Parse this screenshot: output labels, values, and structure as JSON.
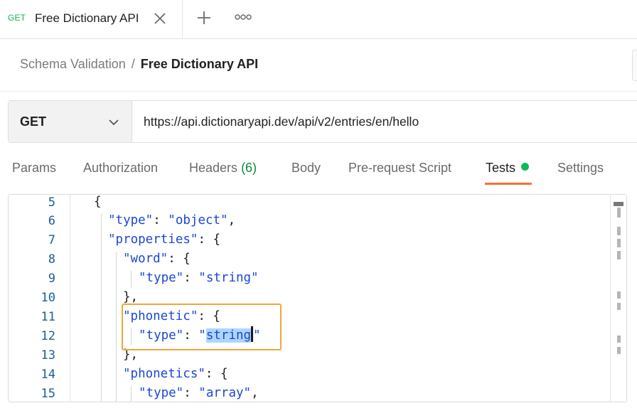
{
  "tab": {
    "method": "GET",
    "title": "Free Dictionary API",
    "close_icon": "close-icon",
    "add_icon": "plus-icon",
    "more_icon": "more-options-icon"
  },
  "breadcrumb": {
    "parent": "Schema Validation",
    "separator": "/",
    "current": "Free Dictionary API"
  },
  "request": {
    "method": "GET",
    "url": "https://api.dictionaryapi.dev/api/v2/entries/en/hello"
  },
  "request_tabs": [
    {
      "label": "Params"
    },
    {
      "label": "Authorization"
    },
    {
      "label": "Headers",
      "count": "(6)"
    },
    {
      "label": "Body"
    },
    {
      "label": "Pre-request Script"
    },
    {
      "label": "Tests",
      "active": true
    },
    {
      "label": "Settings"
    }
  ],
  "editor": {
    "line_numbers": [
      "5",
      "6",
      "7",
      "8",
      "9",
      "10",
      "11",
      "12",
      "13",
      "14",
      "15"
    ],
    "lines": [
      {
        "parts": [
          [
            "p",
            "{"
          ]
        ]
      },
      {
        "parts": [
          [
            "k",
            "\"type\""
          ],
          [
            "p",
            ": "
          ],
          [
            "s",
            "\"object\""
          ],
          [
            "p",
            ","
          ]
        ]
      },
      {
        "parts": [
          [
            "k",
            "\"properties\""
          ],
          [
            "p",
            ": {"
          ]
        ]
      },
      {
        "parts": [
          [
            "k",
            "\"word\""
          ],
          [
            "p",
            ": {"
          ]
        ]
      },
      {
        "parts": [
          [
            "k",
            "\"type\""
          ],
          [
            "p",
            ": "
          ],
          [
            "s",
            "\"string\""
          ]
        ]
      },
      {
        "parts": [
          [
            "p",
            "},"
          ]
        ]
      },
      {
        "parts": [
          [
            "k",
            "\"phonetic\""
          ],
          [
            "p",
            ": {"
          ]
        ]
      },
      {
        "parts": [
          [
            "k",
            "\"type\""
          ],
          [
            "p",
            ": "
          ],
          [
            "s",
            "\""
          ],
          [
            "sel",
            "string"
          ],
          [
            "cur",
            ""
          ],
          [
            "s",
            "\""
          ]
        ]
      },
      {
        "parts": [
          [
            "p",
            "},"
          ]
        ]
      },
      {
        "parts": [
          [
            "k",
            "\"phonetics\""
          ],
          [
            "p",
            ": {"
          ]
        ]
      },
      {
        "parts": [
          [
            "k",
            "\"type\""
          ],
          [
            "p",
            ": "
          ],
          [
            "s",
            "\"array\""
          ],
          [
            "p",
            ","
          ]
        ]
      }
    ]
  },
  "colors": {
    "accent_orange": "#ff6c37",
    "get_green": "#0cbb52",
    "json_blue": "#1b47d6",
    "highlight_box": "#f2a53a",
    "selection": "#add6ff"
  }
}
